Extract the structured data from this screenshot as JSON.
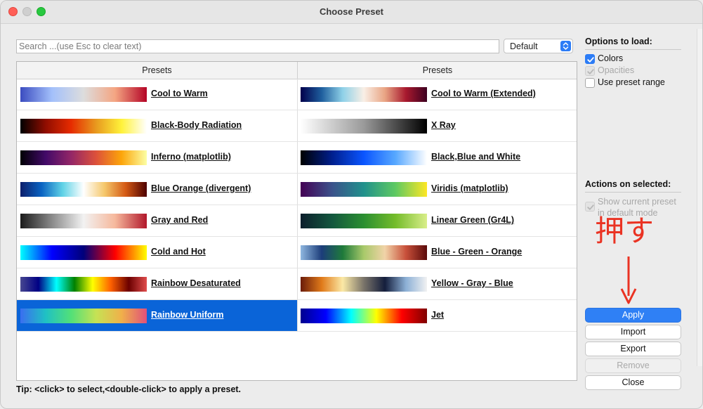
{
  "window": {
    "title": "Choose Preset"
  },
  "search": {
    "placeholder": "Search ...(use Esc to clear text)",
    "value": ""
  },
  "filter": {
    "selected": "Default"
  },
  "table": {
    "headers": [
      "Presets",
      "Presets"
    ],
    "rows": [
      [
        {
          "name": "Cool to Warm",
          "colors": [
            "#3b4cc0",
            "#a3c0fb",
            "#dddddd",
            "#f4a582",
            "#b40426"
          ],
          "selected": false
        },
        {
          "name": "Cool to Warm (Extended)",
          "colors": [
            "#00004c",
            "#1f5f9e",
            "#8fd1e8",
            "#f9efe6",
            "#e9a584",
            "#a8192e",
            "#3d0020"
          ],
          "selected": false
        }
      ],
      [
        {
          "name": "Black-Body Radiation",
          "colors": [
            "#000000",
            "#900d00",
            "#e62b00",
            "#e89a1f",
            "#fff23a",
            "#ffffff"
          ],
          "selected": false
        },
        {
          "name": "X Ray",
          "colors": [
            "#ffffff",
            "#9a9a9a",
            "#000000"
          ],
          "selected": false
        }
      ],
      [
        {
          "name": "Inferno (matplotlib)",
          "colors": [
            "#000004",
            "#420a68",
            "#932667",
            "#dd513a",
            "#fca50a",
            "#fcffa4"
          ],
          "selected": false
        },
        {
          "name": "Black,Blue and White",
          "colors": [
            "#000000",
            "#001f8e",
            "#0a55ff",
            "#57a8ff",
            "#ffffff"
          ],
          "selected": false
        }
      ],
      [
        {
          "name": "Blue Orange (divergent)",
          "colors": [
            "#0c1e6b",
            "#0a63c2",
            "#5fd2e6",
            "#ffffff",
            "#f5c76a",
            "#d45a15",
            "#4d0000"
          ],
          "selected": false
        },
        {
          "name": "Viridis (matplotlib)",
          "colors": [
            "#440154",
            "#3b528b",
            "#21918c",
            "#5ec962",
            "#fde725"
          ],
          "selected": false
        }
      ],
      [
        {
          "name": "Gray and Red",
          "colors": [
            "#1a1a1a",
            "#8a8a8a",
            "#f2f2f2",
            "#f6b89c",
            "#b2182b"
          ],
          "selected": false
        },
        {
          "name": "Linear Green (Gr4L)",
          "colors": [
            "#0c1e2c",
            "#13573e",
            "#2b8f31",
            "#74bc2a",
            "#d9ee8a"
          ],
          "selected": false
        }
      ],
      [
        {
          "name": "Cold and Hot",
          "colors": [
            "#00ffff",
            "#0000ff",
            "#00007a",
            "#ff0000",
            "#ffff00"
          ],
          "selected": false
        },
        {
          "name": "Blue - Green - Orange",
          "colors": [
            "#8fb7e0",
            "#1c3d7a",
            "#1e7a3a",
            "#a8c96a",
            "#f1d3a8",
            "#c8503a",
            "#5a0a0a"
          ],
          "selected": false
        }
      ],
      [
        {
          "name": "Rainbow Desaturated",
          "colors": [
            "#474790",
            "#000084",
            "#00ffff",
            "#008000",
            "#ffff00",
            "#ff6100",
            "#6b0000",
            "#e04c4c"
          ],
          "selected": false
        },
        {
          "name": "Yellow - Gray - Blue",
          "colors": [
            "#6b1c0a",
            "#e07a1a",
            "#fbe9a6",
            "#7a746a",
            "#141e3c",
            "#8cb0d6",
            "#f2f2f2"
          ],
          "selected": false
        }
      ],
      [
        {
          "name": "Rainbow Uniform",
          "colors": [
            "#3a6ef0",
            "#1fc1c4",
            "#52e078",
            "#c6e254",
            "#f0b04a",
            "#e0507a"
          ],
          "selected": true
        },
        {
          "name": "Jet",
          "colors": [
            "#00008f",
            "#0000ff",
            "#00ffff",
            "#ffff00",
            "#ff0000",
            "#800000"
          ],
          "selected": false
        }
      ]
    ]
  },
  "tip": "Tip: <click> to select,<double-click> to apply a preset.",
  "options": {
    "heading": "Options to load:",
    "items": [
      {
        "label": "Colors",
        "checked": true,
        "enabled": true
      },
      {
        "label": "Opacities",
        "checked": true,
        "enabled": false
      },
      {
        "label": "Use preset range",
        "checked": false,
        "enabled": true
      }
    ]
  },
  "actions": {
    "heading": "Actions on selected:",
    "show_current": {
      "line1": "Show current preset",
      "line2": "in default mode",
      "checked": true,
      "enabled": false
    }
  },
  "buttons": {
    "apply": "Apply",
    "import": "Import",
    "export": "Export",
    "remove": "Remove",
    "close": "Close"
  },
  "annotation": {
    "text": "押す",
    "color": "#ea3323"
  }
}
